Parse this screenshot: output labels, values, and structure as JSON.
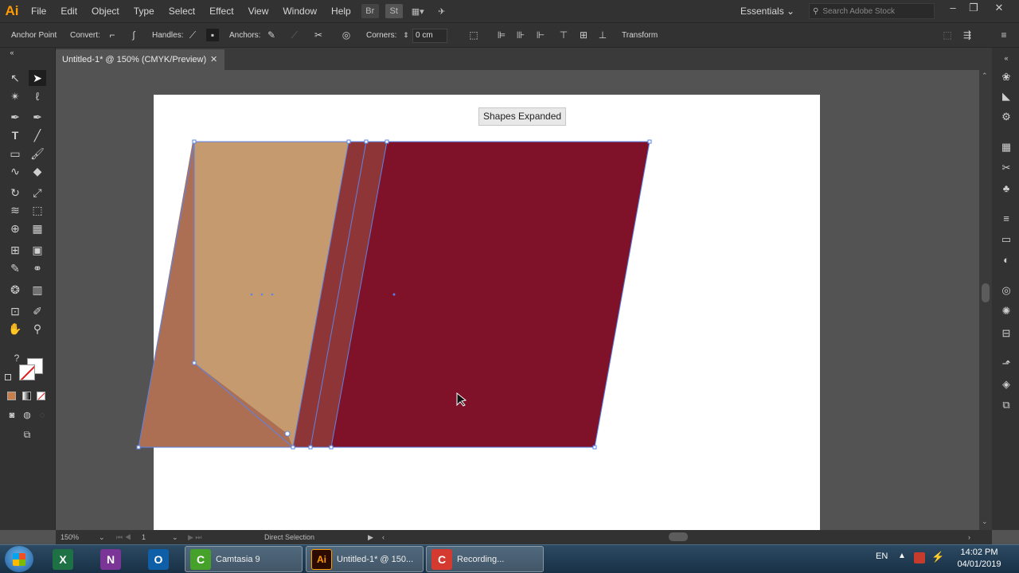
{
  "app": {
    "logo": "Ai"
  },
  "menu": [
    "File",
    "Edit",
    "Object",
    "Type",
    "Select",
    "Effect",
    "View",
    "Window",
    "Help"
  ],
  "menu_icons": {
    "bridge": "Br",
    "stock": "St"
  },
  "workspace": "Essentials",
  "search_placeholder": "Search Adobe Stock",
  "control_bar": {
    "anchor_point": "Anchor Point",
    "convert": "Convert:",
    "handles": "Handles:",
    "anchors": "Anchors:",
    "corners": "Corners:",
    "corner_value": "0 cm",
    "transform": "Transform"
  },
  "document_tab": {
    "title": "Untitled-1* @ 150% (CMYK/Preview)"
  },
  "canvas": {
    "tooltip": "Shapes Expanded",
    "colors": {
      "artboard": "#ffffff",
      "maroon": "#7f1128",
      "tan": "#c59a6e",
      "terracotta": "#ad6f54",
      "rust": "#8e3637",
      "selection": "#5b84e8"
    }
  },
  "status_bar": {
    "zoom": "150%",
    "artboard_number": "1",
    "tool": "Direct Selection"
  },
  "taskbar": {
    "apps": [
      {
        "name": "Excel",
        "letter": "X",
        "color": "#1d7144"
      },
      {
        "name": "OneNote",
        "letter": "N",
        "color": "#7a3596"
      },
      {
        "name": "Outlook",
        "letter": "O",
        "color": "#0f5fa8"
      }
    ],
    "windows": [
      {
        "label": "Camtasia 9",
        "letter": "C",
        "color": "#46a12b"
      },
      {
        "label": "Untitled-1* @ 150...",
        "letter": "Ai",
        "color": "#2b0b00"
      },
      {
        "label": "Recording...",
        "letter": "C",
        "color": "#d43a2f"
      }
    ],
    "language": "EN",
    "time": "14:02 PM",
    "date": "04/01/2019"
  }
}
